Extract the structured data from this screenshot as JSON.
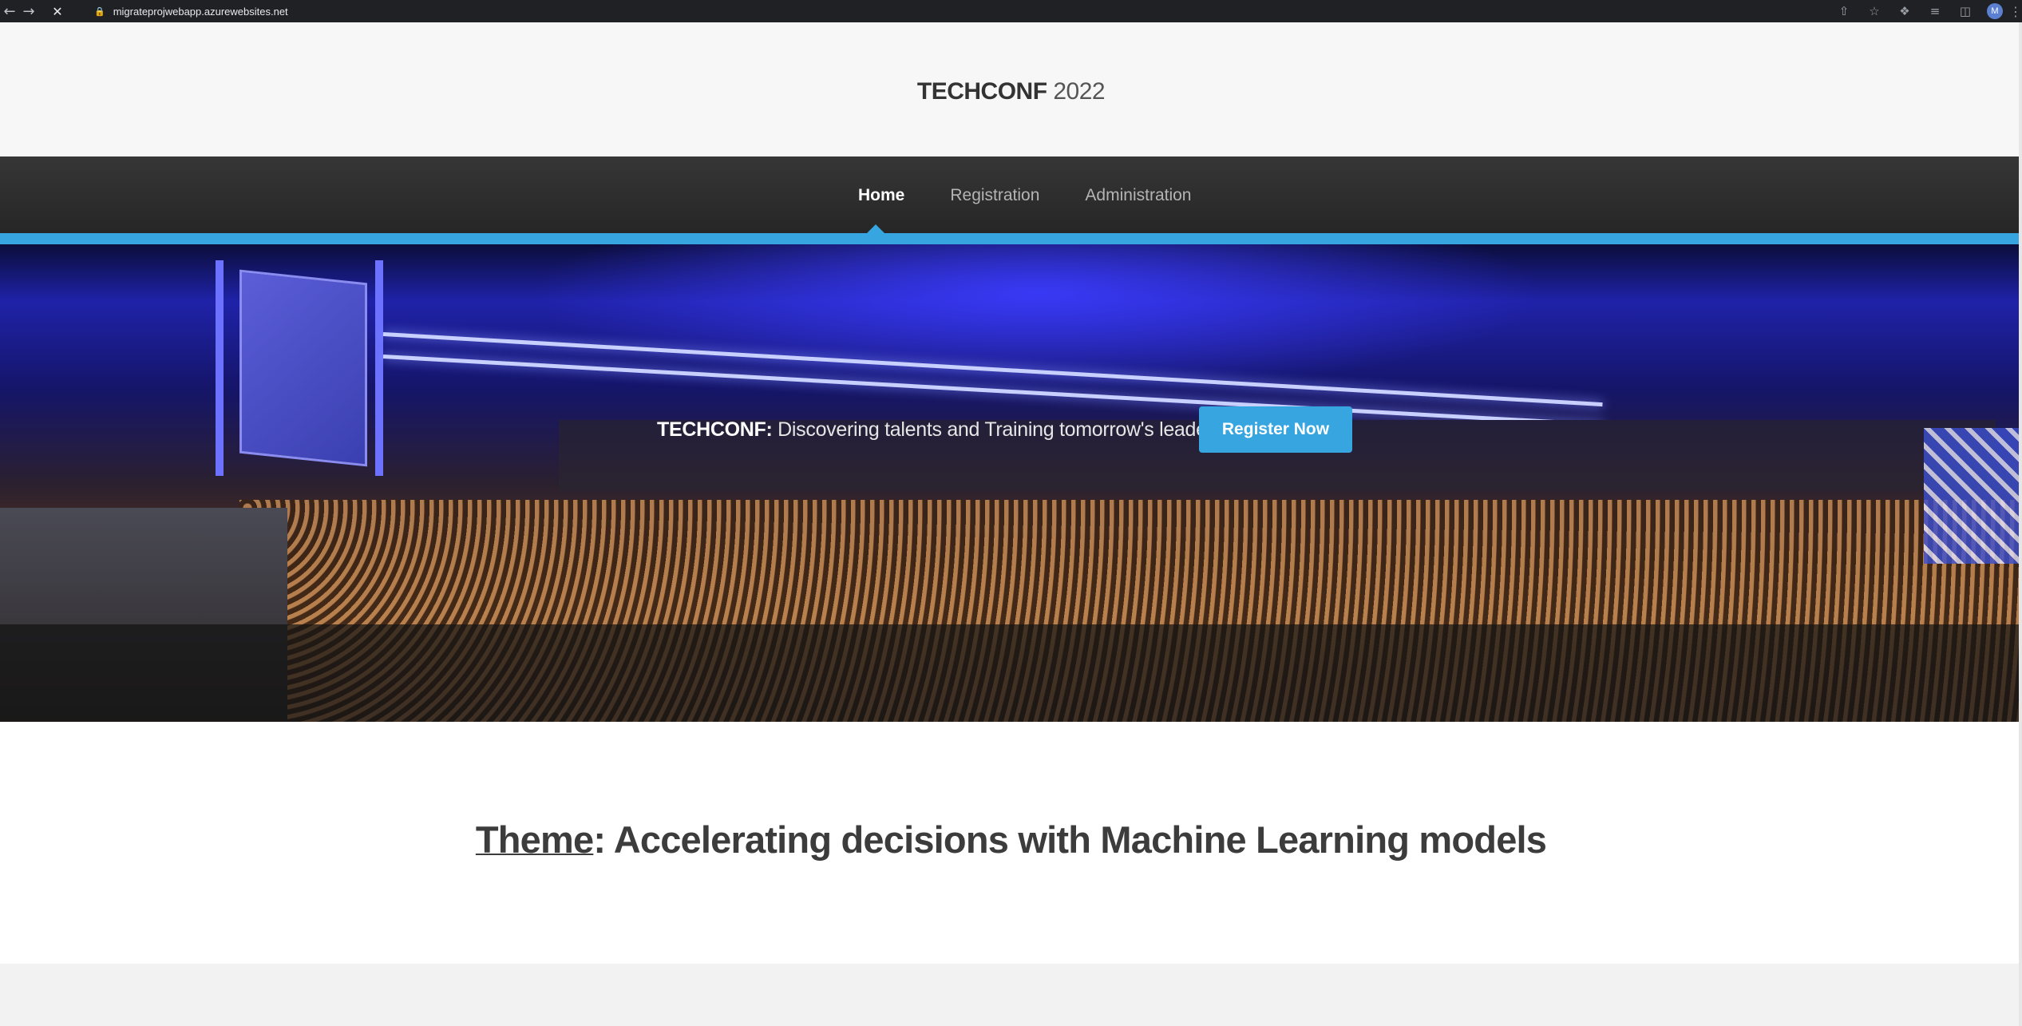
{
  "browser": {
    "back_icon": "back-arrow-icon",
    "forward_icon": "forward-arrow-icon",
    "stop_icon": "stop-loading-icon",
    "url": "migrateprojwebapp.azurewebsites.net",
    "avatar_initial": "M"
  },
  "header": {
    "brand": "TECHCONF",
    "year": "2022"
  },
  "nav": {
    "items": [
      {
        "label": "Home",
        "active": true
      },
      {
        "label": "Registration",
        "active": false
      },
      {
        "label": "Administration",
        "active": false
      }
    ],
    "accent_color": "#37a6e0"
  },
  "hero": {
    "tagline_brand": "TECHCONF:",
    "tagline_text": " Discovering talents and Training tomorrow's leaders",
    "register_label": "Register Now"
  },
  "theme": {
    "label": "Theme",
    "text": ": Accelerating decisions with Machine Learning models"
  }
}
